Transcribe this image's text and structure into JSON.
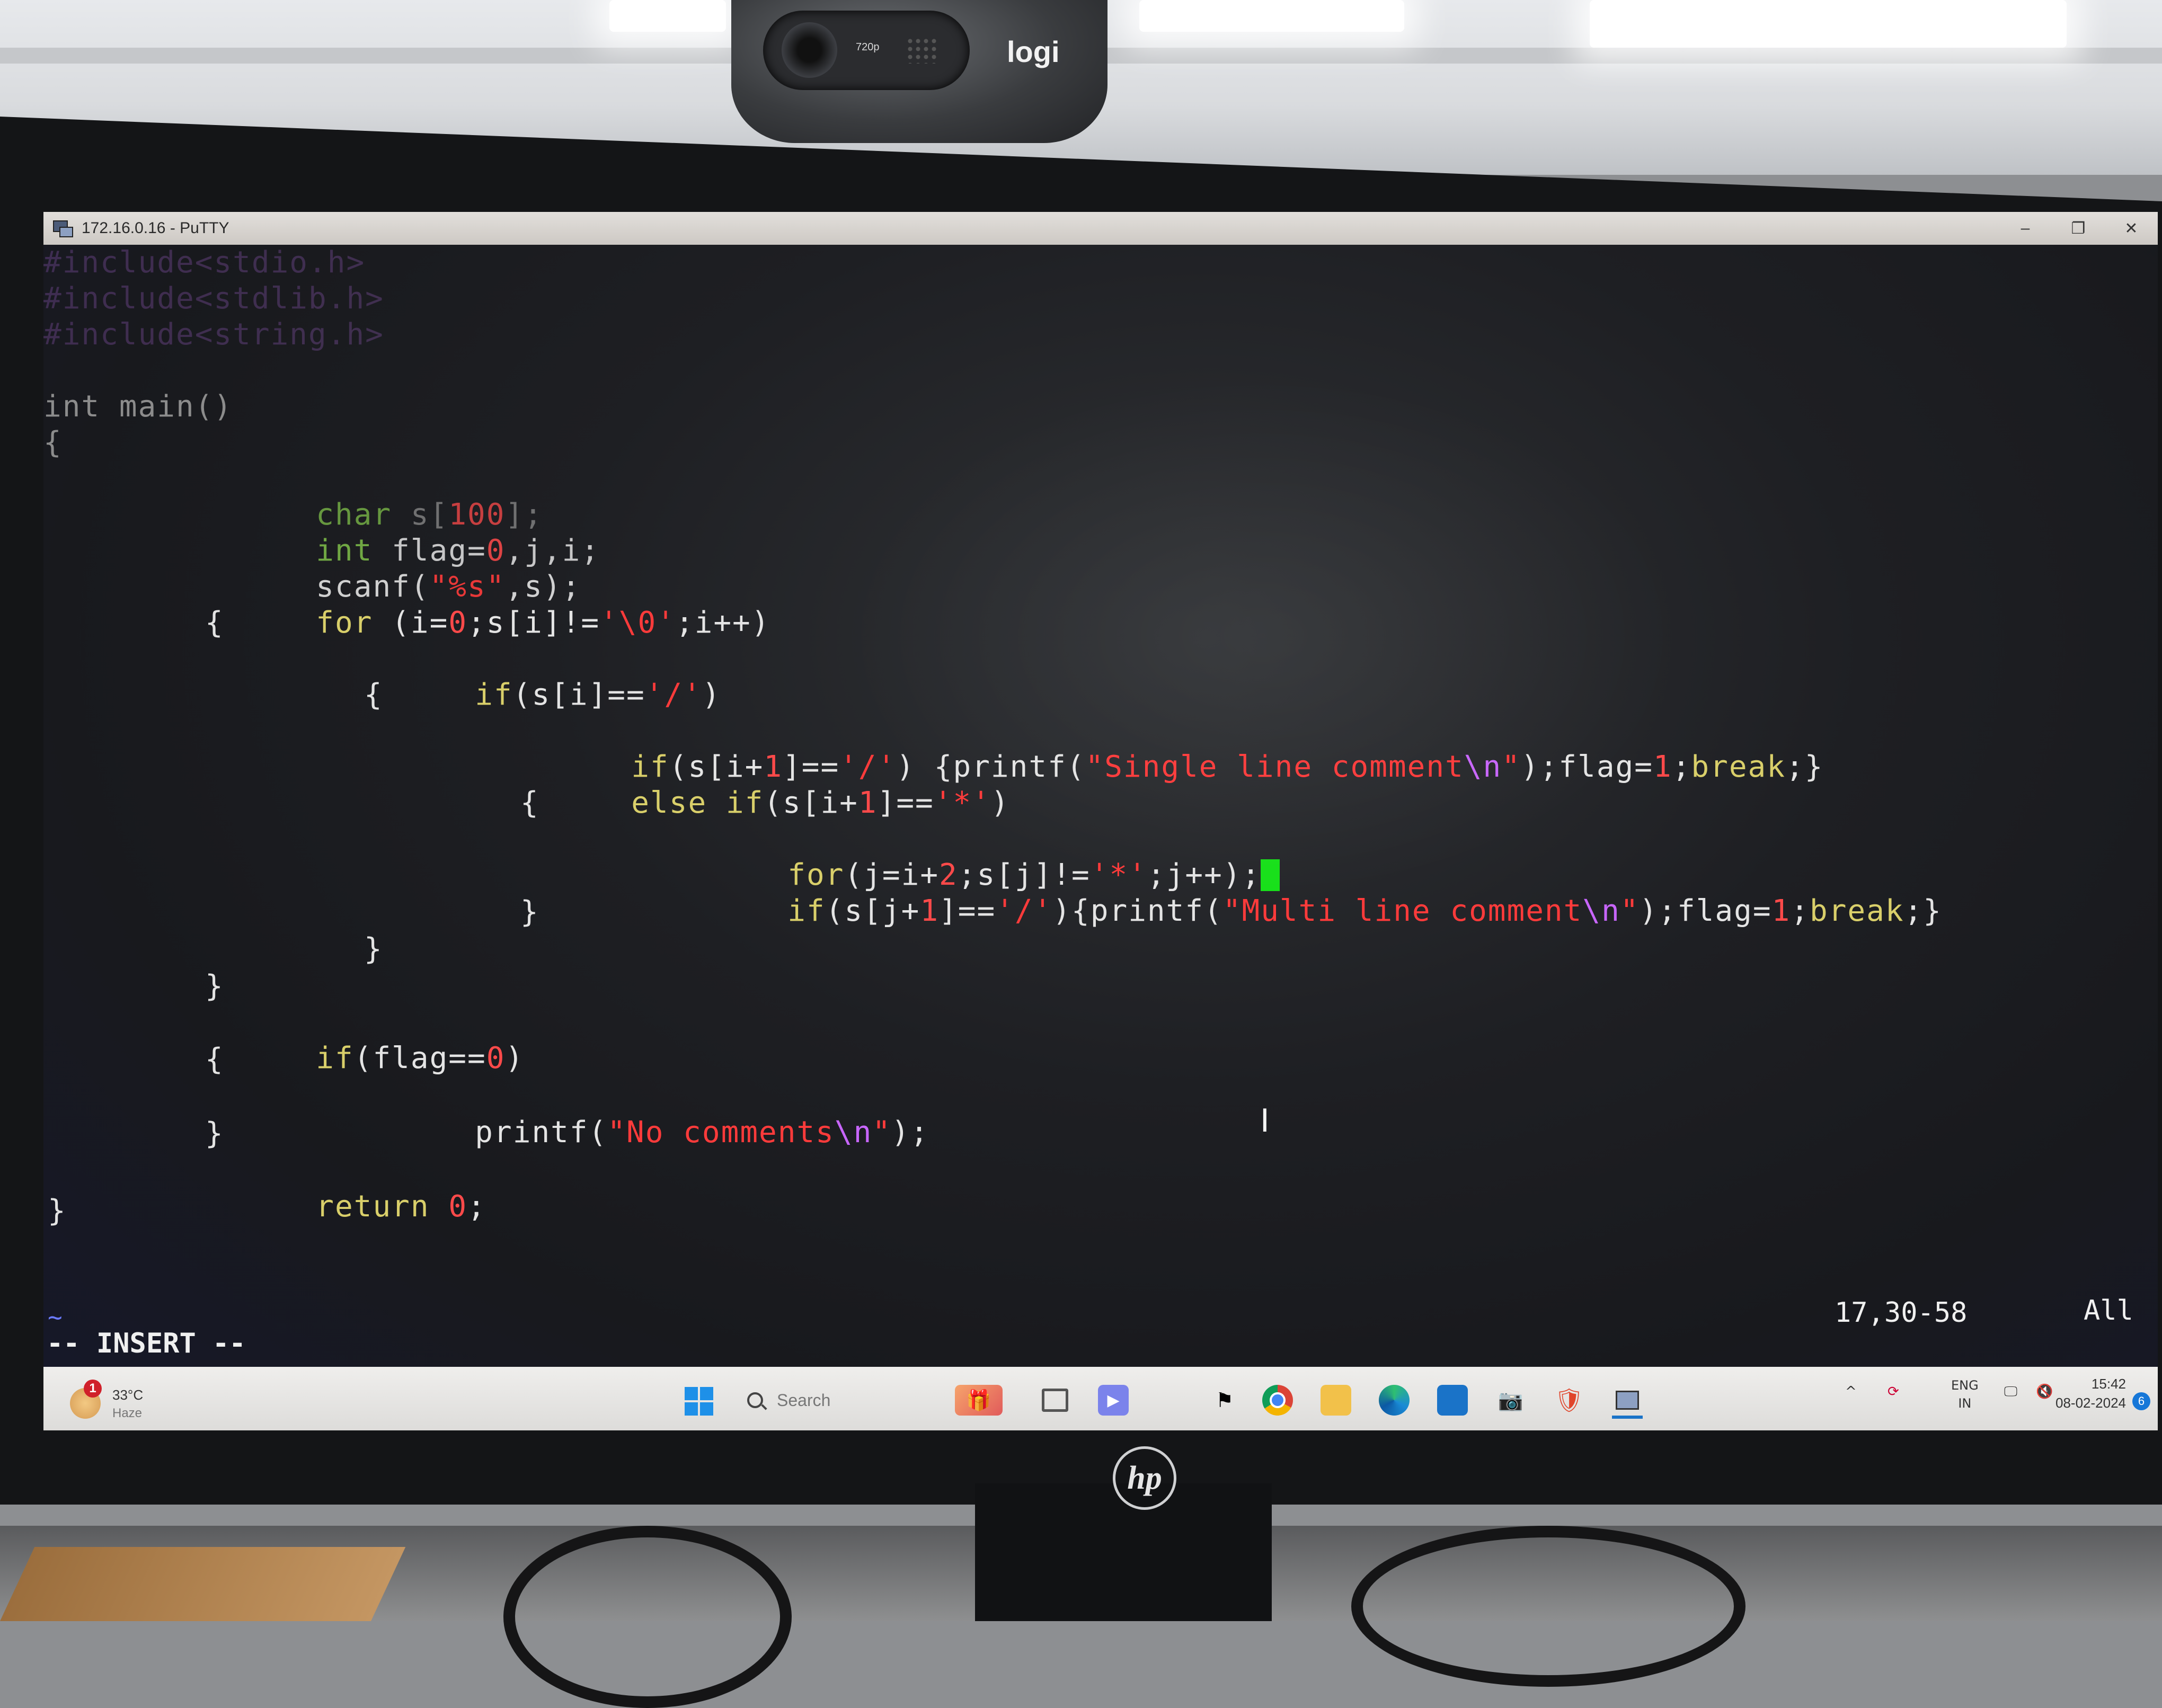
{
  "window": {
    "title": "172.16.0.16 - PuTTY",
    "controls": {
      "minimize": "–",
      "restore": "❐",
      "close": "✕"
    }
  },
  "webcam": {
    "brand": "logi",
    "resolution": "720p"
  },
  "monitor": {
    "brand": "hp"
  },
  "code": {
    "include1": "#include<stdio.h>",
    "include2": "#include<stdlib.h>",
    "include3": "#include<string.h>",
    "main_sig": "int main()",
    "brace_open": "{",
    "l_char": [
      "char",
      " s[",
      "100",
      "];"
    ],
    "l_int": [
      "int",
      " flag=",
      "0",
      ",j,i;"
    ],
    "l_scanf": [
      "scanf(",
      "\"%s\"",
      ",s);"
    ],
    "l_for": [
      "for",
      " (i=",
      "0",
      ";s[i]!=",
      "'\\0'",
      ";i++)"
    ],
    "l_open2": "{",
    "l_if1": [
      "if",
      "(s[i]==",
      "'/'",
      ")"
    ],
    "l_open3": "{",
    "l_if2": [
      "if",
      "(s[i+",
      "1",
      "]==",
      "'/'",
      ") {printf(",
      "\"Single line comment",
      "\\n",
      "\"",
      ");flag=",
      "1",
      ";",
      "break",
      ";}"
    ],
    "l_elseif": [
      "else if",
      "(s[i+",
      "1",
      "]==",
      "'*'",
      ")"
    ],
    "l_open4": "{",
    "l_for2": [
      "for",
      "(j=i+",
      "2",
      ";s[j]!=",
      "'*'",
      ";j++);"
    ],
    "l_if3": [
      "if",
      "(s[j+",
      "1",
      "]==",
      "'/'",
      "){printf(",
      "\"Multi line comment",
      "\\n",
      "\"",
      ");flag=",
      "1",
      ";",
      "break",
      ";}"
    ],
    "l_close4": "}",
    "l_close3": "}",
    "l_close2": "}",
    "l_ifflag": [
      "if",
      "(flag==",
      "0",
      ")"
    ],
    "l_open5": "{",
    "l_printf": [
      "printf(",
      "\"No comments",
      "\\n",
      "\"",
      ");"
    ],
    "l_close5": "}",
    "l_return": [
      "return",
      " ",
      "0",
      ";"
    ],
    "brace_close": "}"
  },
  "statusline": {
    "tilde": "~",
    "mode": "-- INSERT --",
    "position": "17,30-58",
    "scroll": "All"
  },
  "taskbar": {
    "weather_temp": "33°C",
    "weather_cond": "Haze",
    "weather_badge": "1",
    "search_placeholder": "Search",
    "lang_top": "ENG",
    "lang_bottom": "IN",
    "time": "15:42",
    "date": "08-02-2024",
    "notifications": "6"
  }
}
